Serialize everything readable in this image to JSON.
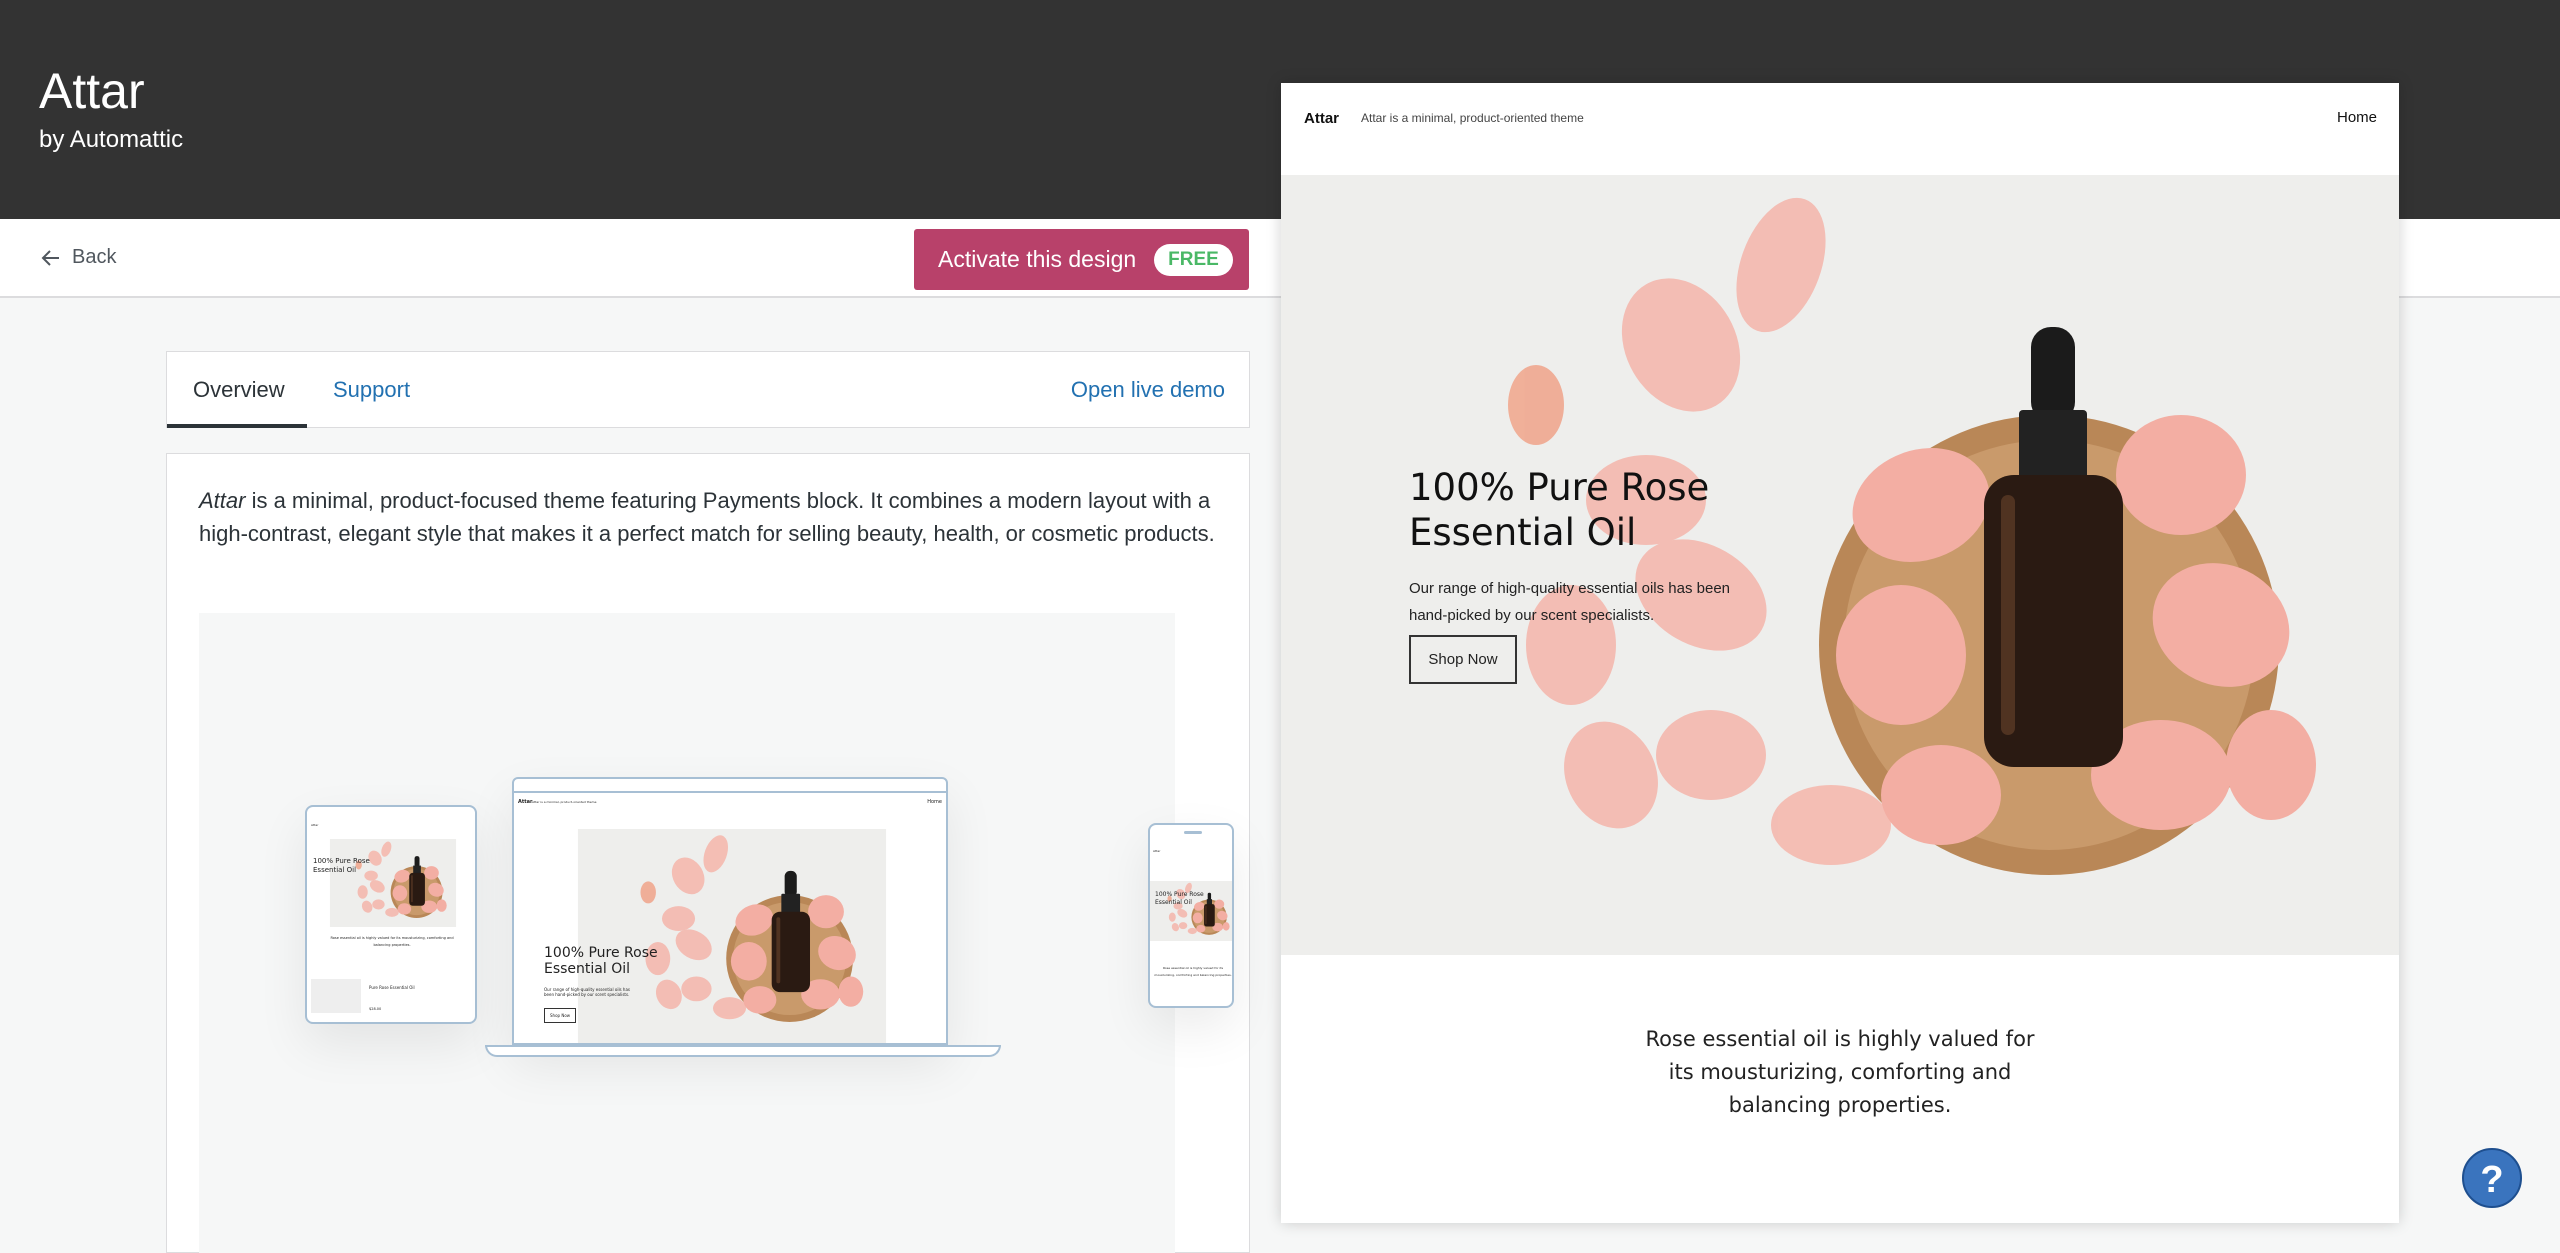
{
  "header": {
    "title": "Attar",
    "byline": "by Automattic"
  },
  "toolbar": {
    "back_label": "Back",
    "activate_label": "Activate this design",
    "price_badge": "FREE",
    "accent_color": "#b8416a"
  },
  "tabs": {
    "items": [
      {
        "label": "Overview",
        "active": true
      },
      {
        "label": "Support",
        "active": false
      }
    ],
    "live_demo": "Open live demo"
  },
  "description": {
    "theme_name": "Attar",
    "text": " is a minimal, product-focused theme featuring Payments block. It combines a modern layout with a high-contrast, elegant style that makes it a perfect match for selling beauty, health, or cosmetic products."
  },
  "preview": {
    "site_title": "Attar",
    "tagline": "Attar is a minimal, product-oriented theme",
    "nav_home": "Home",
    "hero_heading": "100% Pure Rose Essential Oil",
    "hero_text": "Our range of high-quality essential oils has been hand-picked by our scent specialists.",
    "hero_button": "Shop Now",
    "body_text": "Rose essential oil is highly valued for its mousturizing, comforting and balancing properties."
  },
  "mockup": {
    "product_name": "Pure Rose Essential Oil",
    "product_price": "$28.00"
  },
  "help": {
    "label": "?"
  }
}
